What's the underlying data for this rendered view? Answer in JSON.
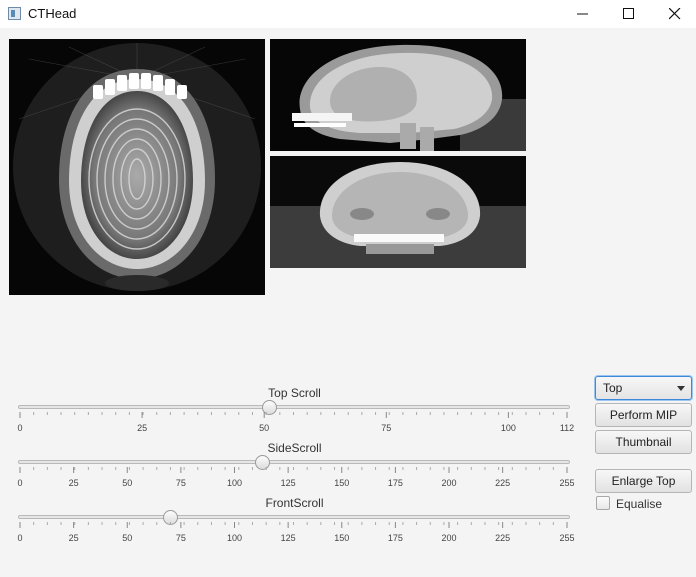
{
  "window": {
    "title": "CTHead",
    "minimize_glyph": "—",
    "maximize_glyph": "☐",
    "close_glyph": "✕"
  },
  "sliders": [
    {
      "label": "Top Scroll",
      "min": 0,
      "max": 112,
      "value": 51,
      "ticks": [
        "0",
        "25",
        "50",
        "75",
        "100",
        "112"
      ]
    },
    {
      "label": "SideScroll",
      "min": 0,
      "max": 255,
      "value": 113,
      "ticks": [
        "0",
        "25",
        "50",
        "75",
        "100",
        "125",
        "150",
        "175",
        "200",
        "225",
        "255"
      ]
    },
    {
      "label": "FrontScroll",
      "min": 0,
      "max": 255,
      "value": 70,
      "ticks": [
        "0",
        "25",
        "50",
        "75",
        "100",
        "125",
        "150",
        "175",
        "200",
        "225",
        "255"
      ]
    }
  ],
  "controls": {
    "view_select": {
      "value": "Top"
    },
    "perform_mip": "Perform MIP",
    "thumbnail": "Thumbnail",
    "enlarge_top": "Enlarge Top",
    "equalise": {
      "label": "Equalise",
      "checked": false
    }
  },
  "colors": {
    "focus_accent": "#3c8ad9",
    "image_background": "#060606"
  }
}
